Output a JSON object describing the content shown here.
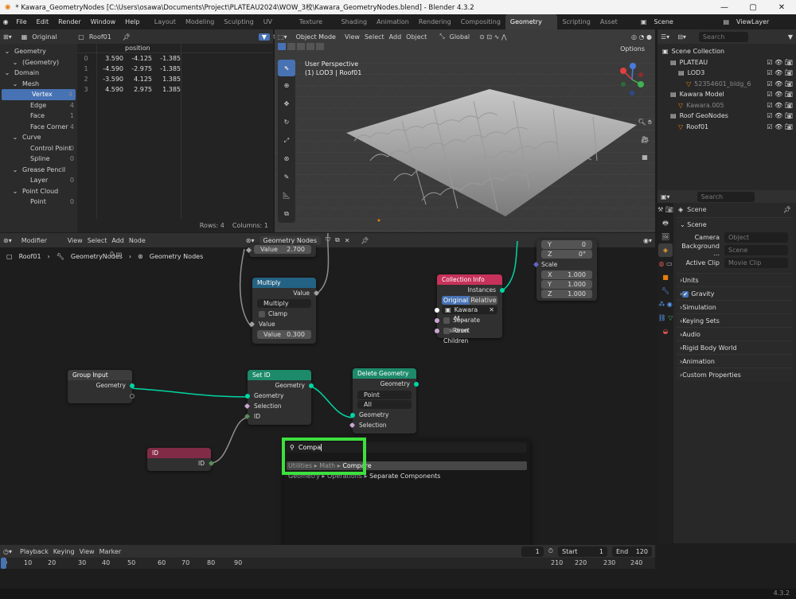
{
  "window": {
    "title": "* Kawara_GeometryNodes [C:\\Users\\osawa\\Documents\\Project\\PLATEAU2024\\WOW_3校\\Kawara_GeometryNodes.blend] - Blender 4.3.2",
    "min": "—",
    "max": "▢",
    "close": "✕"
  },
  "menu": {
    "items": [
      "File",
      "Edit",
      "Render",
      "Window",
      "Help"
    ],
    "workspaces": [
      "Layout",
      "Modeling",
      "Sculpting",
      "UV Editing",
      "Texture Paint",
      "Shading",
      "Animation",
      "Rendering",
      "Compositing",
      "Geometry Nodes",
      "Scripting",
      "Asset Browser"
    ],
    "active_workspace": "Geometry Nodes",
    "scene": "Scene",
    "view_layer": "ViewLayer"
  },
  "spreadsheet": {
    "mode": "Original",
    "object": "Roof01",
    "tree": [
      {
        "label": "Geometry",
        "lvl": 0
      },
      {
        "label": "(Geometry)",
        "lvl": 1
      },
      {
        "label": "Domain",
        "lvl": 0
      },
      {
        "label": "Mesh",
        "lvl": 1
      },
      {
        "label": "Vertex",
        "lvl": 2,
        "count": "4",
        "active": true
      },
      {
        "label": "Edge",
        "lvl": 2,
        "count": "4"
      },
      {
        "label": "Face",
        "lvl": 2,
        "count": "1"
      },
      {
        "label": "Face Corner",
        "lvl": 2,
        "count": "4"
      },
      {
        "label": "Curve",
        "lvl": 1
      },
      {
        "label": "Control Point",
        "lvl": 2,
        "count": "0"
      },
      {
        "label": "Spline",
        "lvl": 2,
        "count": "0"
      },
      {
        "label": "Grease Pencil",
        "lvl": 1
      },
      {
        "label": "Layer",
        "lvl": 2,
        "count": "0"
      },
      {
        "label": "Point Cloud",
        "lvl": 1
      },
      {
        "label": "Point",
        "lvl": 2,
        "count": "0"
      }
    ],
    "column": "position",
    "rows": [
      [
        "0",
        "3.590",
        "-4.125",
        "-1.385"
      ],
      [
        "1",
        "-4.590",
        "-2.975",
        "-1.385"
      ],
      [
        "2",
        "-3.590",
        "4.125",
        "1.385"
      ],
      [
        "3",
        "4.590",
        "2.975",
        "1.385"
      ]
    ],
    "footer_rows": "Rows: 4",
    "footer_cols": "Columns: 1"
  },
  "viewport": {
    "mode": "Object Mode",
    "menus": [
      "View",
      "Select",
      "Add",
      "Object"
    ],
    "orientation": "Global",
    "options": "Options",
    "persp": "User Perspective",
    "obj": "(1) LOD3 | Roof01"
  },
  "outliner": {
    "search": "Search",
    "items": [
      {
        "label": "Scene Collection",
        "lvl": 0
      },
      {
        "label": "PLATEAU",
        "lvl": 1
      },
      {
        "label": "LOD3",
        "lvl": 2
      },
      {
        "label": "52354601_bldg_6",
        "lvl": 3,
        "dim": true
      },
      {
        "label": "Kawara Model",
        "lvl": 1
      },
      {
        "label": "Kawara.005",
        "lvl": 2,
        "dim": true
      },
      {
        "label": "Roof GeoNodes",
        "lvl": 1
      },
      {
        "label": "Roof01",
        "lvl": 2
      }
    ]
  },
  "properties": {
    "search": "Search",
    "title": "Scene",
    "section": "Scene",
    "fields": [
      {
        "label": "Camera",
        "value": "Object"
      },
      {
        "label": "Background ...",
        "value": "Scene"
      },
      {
        "label": "Active Clip",
        "value": "Movie Clip"
      }
    ],
    "sections": [
      "Units",
      "Gravity",
      "Simulation",
      "Keying Sets",
      "Audio",
      "Rigid Body World",
      "Animation",
      "Custom Properties"
    ]
  },
  "node_editor": {
    "mode": "Modifier",
    "menus": [
      "View",
      "Select",
      "Add",
      "Node"
    ],
    "tree": "Geometry Nodes",
    "breadcrumb": [
      "Roof01",
      "GeometryNodes",
      "Geometry Nodes"
    ],
    "hint": "0 m",
    "nodes": {
      "value_top": {
        "label": "Value",
        "val": "2.700"
      },
      "multiply": {
        "title": "Multiply",
        "out": "Value",
        "op": "Multiply",
        "clamp": "Clamp",
        "in": "Value",
        "val_label": "Value",
        "val": "0.300"
      },
      "collection": {
        "title": "Collection Info",
        "out": "Instances",
        "tabs": [
          "Original",
          "Relative"
        ],
        "coll": "Kawara M...",
        "sep": "Separate Children",
        "reset": "Reset Children"
      },
      "transform": {
        "y": "0",
        "z": "0°",
        "scale": "Scale",
        "x_lbl": "X",
        "x": "1.000",
        "y_lbl": "Y",
        "y2": "1.000",
        "z_lbl": "Z",
        "z2": "1.000",
        "y1_lbl": "Y",
        "z1_lbl": "Z"
      },
      "group_input": {
        "title": "Group Input",
        "out": "Geometry"
      },
      "set_id": {
        "title": "Set ID",
        "out": "Geometry",
        "in1": "Geometry",
        "in2": "Selection",
        "in3": "ID"
      },
      "delete": {
        "title": "Delete Geometry",
        "out": "Geometry",
        "dd1": "Point",
        "dd2": "All",
        "in1": "Geometry",
        "in2": "Selection"
      },
      "id": {
        "title": "ID",
        "out": "ID"
      }
    },
    "search": {
      "query": "Compa",
      "result1_path": "Utilities ▸ Math ▸",
      "result1": "Compare",
      "result2_path": "Geometry ▸ Operations ▸",
      "result2": "Separate Components"
    }
  },
  "timeline": {
    "menus": [
      "Playback",
      "Keying",
      "View",
      "Marker"
    ],
    "frame": "1",
    "start_lbl": "Start",
    "start": "1",
    "end_lbl": "End",
    "end": "120",
    "ticks": [
      "0",
      "10",
      "20",
      "30",
      "40",
      "50",
      "60",
      "70",
      "80",
      "90",
      "210",
      "220",
      "230",
      "240"
    ]
  },
  "status": {
    "version": "4.3.2"
  },
  "colors": {
    "highlight": "#3ee03e",
    "geometry_socket": "#00d6a3",
    "vertex_active": "#4772b3"
  }
}
